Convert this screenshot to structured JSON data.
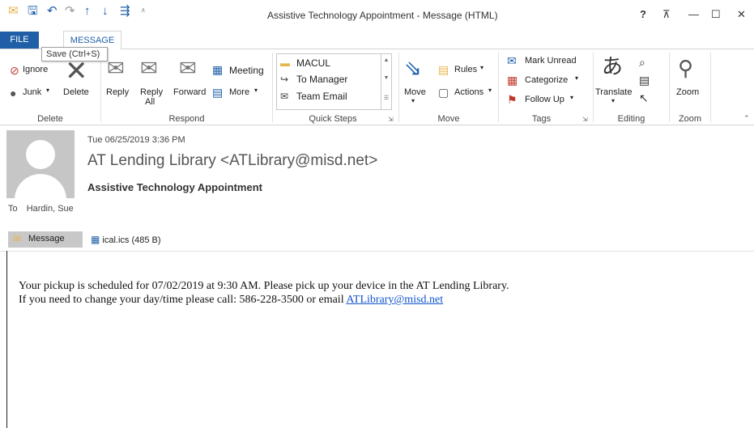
{
  "window": {
    "title": "Assistive Technology Appointment - Message (HTML)",
    "help": "?",
    "restore_ribbon": "⊼",
    "minimize": "—",
    "maximize": "☐",
    "close": "✕"
  },
  "tabs": {
    "file": "FILE",
    "message": "MESSAGE"
  },
  "tooltip": "Save (Ctrl+S)",
  "ribbon": {
    "delete_group": {
      "ignore": "Ignore",
      "junk": "Junk",
      "delete": "Delete",
      "label": "Delete"
    },
    "respond_group": {
      "reply": "Reply",
      "reply_all_1": "Reply",
      "reply_all_2": "All",
      "forward": "Forward",
      "meeting": "Meeting",
      "more": "More",
      "label": "Respond"
    },
    "quick_steps": {
      "items": [
        "MACUL",
        "To Manager",
        "Team Email"
      ],
      "label": "Quick Steps"
    },
    "move_group": {
      "move": "Move",
      "rules": "Rules",
      "actions": "Actions",
      "label": "Move"
    },
    "tags_group": {
      "mark_unread": "Mark Unread",
      "categorize": "Categorize",
      "follow_up": "Follow Up",
      "label": "Tags"
    },
    "editing_group": {
      "translate": "Translate",
      "label": "Editing"
    },
    "zoom_group": {
      "zoom": "Zoom",
      "label": "Zoom"
    }
  },
  "message": {
    "date": "Tue 06/25/2019 3:36 PM",
    "from": "AT Lending Library <ATLibrary@misd.net>",
    "subject": "Assistive Technology Appointment",
    "to_label": "To",
    "to_value": "Hardin, Sue",
    "message_tab": "Message",
    "attachment": "ical.ics (485 B)",
    "body_line1": "Your pickup is scheduled for 07/02/2019 at 9:30 AM. Please pick up your device in the AT Lending Library.",
    "body_line2_prefix": "If you need to change your day/time please call: 586-228-3500 or email ",
    "body_link": "ATLibrary@misd.net"
  },
  "colors": {
    "accent": "#1f5fa8",
    "link": "#1155cc"
  }
}
